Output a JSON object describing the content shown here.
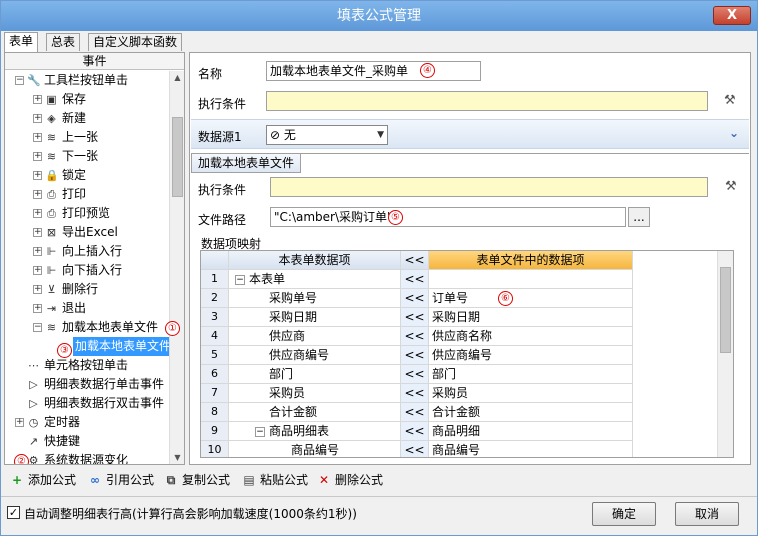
{
  "window": {
    "title": "填表公式管理",
    "close_label": "X"
  },
  "tabs": [
    "表单",
    "总表",
    "自定义脚本函数"
  ],
  "left_panel": {
    "header": "事件",
    "tree": [
      {
        "label": "工具栏按钮单击",
        "icon": "wrench-icon",
        "glyph": "🔧",
        "level": 0,
        "expander": "−"
      },
      {
        "label": "保存",
        "icon": "save-icon",
        "glyph": "▣",
        "level": 1,
        "expander": "+"
      },
      {
        "label": "新建",
        "icon": "new-icon",
        "glyph": "◈",
        "level": 1,
        "expander": "+"
      },
      {
        "label": "上一张",
        "icon": "prev-icon",
        "glyph": "≋",
        "level": 1,
        "expander": "+"
      },
      {
        "label": "下一张",
        "icon": "next-icon",
        "glyph": "≋",
        "level": 1,
        "expander": "+"
      },
      {
        "label": "锁定",
        "icon": "lock-icon",
        "glyph": "🔒",
        "level": 1,
        "expander": "+"
      },
      {
        "label": "打印",
        "icon": "print-icon",
        "glyph": "⎙",
        "level": 1,
        "expander": "+"
      },
      {
        "label": "打印预览",
        "icon": "print-preview-icon",
        "glyph": "⎙",
        "level": 1,
        "expander": "+"
      },
      {
        "label": "导出Excel",
        "icon": "excel-icon",
        "glyph": "⊠",
        "level": 1,
        "expander": "+"
      },
      {
        "label": "向上插入行",
        "icon": "insert-up-icon",
        "glyph": "⊩",
        "level": 1,
        "expander": "+"
      },
      {
        "label": "向下插入行",
        "icon": "insert-down-icon",
        "glyph": "⊩",
        "level": 1,
        "expander": "+"
      },
      {
        "label": "删除行",
        "icon": "delete-row-icon",
        "glyph": "⊻",
        "level": 1,
        "expander": "+"
      },
      {
        "label": "退出",
        "icon": "exit-icon",
        "glyph": "⇥",
        "level": 1,
        "expander": "+"
      },
      {
        "label": "加载本地表单文件",
        "icon": "load-file-icon",
        "glyph": "≋",
        "level": 1,
        "expander": "−"
      },
      {
        "label": "加载本地表单文件",
        "icon": "",
        "glyph": "",
        "level": 2,
        "expander": "",
        "selected": true
      },
      {
        "label": "单元格按钮单击",
        "icon": "cell-button-icon",
        "glyph": "⋯",
        "level": 0,
        "expander": ""
      },
      {
        "label": "明细表数据行单击事件",
        "icon": "flag-icon",
        "glyph": "▷",
        "level": 0,
        "expander": ""
      },
      {
        "label": "明细表数据行双击事件",
        "icon": "flag-icon",
        "glyph": "▷",
        "level": 0,
        "expander": ""
      },
      {
        "label": "定时器",
        "icon": "timer-icon",
        "glyph": "◷",
        "level": 0,
        "expander": "+"
      },
      {
        "label": "快捷键",
        "icon": "shortcut-icon",
        "glyph": "↗",
        "level": 0,
        "expander": ""
      },
      {
        "label": "系统数据源变化",
        "icon": "datasource-change-icon",
        "glyph": "⚙",
        "level": 0,
        "expander": ""
      }
    ]
  },
  "form": {
    "name_label": "名称",
    "name_value": "加载本地表单文件_采购单",
    "condition_label": "执行条件",
    "condition_value": "",
    "datasource_label": "数据源1",
    "datasource_value": "无",
    "subtab_label": "加载本地表单文件",
    "sub_condition_label": "执行条件",
    "sub_condition_value": "",
    "filepath_label": "文件路径",
    "filepath_value": "\"C:\\amber\\采购订单\"",
    "browse_label": "...",
    "mapping_label": "数据项映射"
  },
  "mapping_table": {
    "headers": [
      "本表单数据项",
      "<<",
      "表单文件中的数据项"
    ],
    "rows": [
      {
        "num": "1",
        "item": "本表单",
        "arrow": "<<",
        "source": "",
        "indent": 0,
        "expander": "−"
      },
      {
        "num": "2",
        "item": "采购单号",
        "arrow": "<<",
        "source": "订单号",
        "indent": 1,
        "expander": ""
      },
      {
        "num": "3",
        "item": "采购日期",
        "arrow": "<<",
        "source": "采购日期",
        "indent": 1,
        "expander": ""
      },
      {
        "num": "4",
        "item": "供应商",
        "arrow": "<<",
        "source": "供应商名称",
        "indent": 1,
        "expander": ""
      },
      {
        "num": "5",
        "item": "供应商编号",
        "arrow": "<<",
        "source": "供应商编号",
        "indent": 1,
        "expander": ""
      },
      {
        "num": "6",
        "item": "部门",
        "arrow": "<<",
        "source": "部门",
        "indent": 1,
        "expander": ""
      },
      {
        "num": "7",
        "item": "采购员",
        "arrow": "<<",
        "source": "采购员",
        "indent": 1,
        "expander": ""
      },
      {
        "num": "8",
        "item": "合计金额",
        "arrow": "<<",
        "source": "合计金额",
        "indent": 1,
        "expander": ""
      },
      {
        "num": "9",
        "item": "商品明细表",
        "arrow": "<<",
        "source": "商品明细",
        "indent": 1,
        "expander": "−"
      },
      {
        "num": "10",
        "item": "商品编号",
        "arrow": "<<",
        "source": "商品编号",
        "indent": 2,
        "expander": ""
      }
    ]
  },
  "toolbar": [
    {
      "label": "添加公式",
      "icon": "add-icon",
      "glyph": "+",
      "color": "#1a9a1a"
    },
    {
      "label": "引用公式",
      "icon": "link-icon",
      "glyph": "∞",
      "color": "#2a6fd0"
    },
    {
      "label": "复制公式",
      "icon": "copy-icon",
      "glyph": "⧉",
      "color": "#444444"
    },
    {
      "label": "粘贴公式",
      "icon": "paste-icon",
      "glyph": "▤",
      "color": "#444444"
    },
    {
      "label": "删除公式",
      "icon": "delete-icon",
      "glyph": "✕",
      "color": "#d00000"
    }
  ],
  "bottom": {
    "checkbox_label": "自动调整明细表行高(计算行高会影响加载速度(1000条约1秒))",
    "checkbox_checked": "✓",
    "ok_label": "确定",
    "cancel_label": "取消"
  },
  "annotations": [
    "①",
    "②",
    "③",
    "④",
    "⑤",
    "⑥"
  ]
}
